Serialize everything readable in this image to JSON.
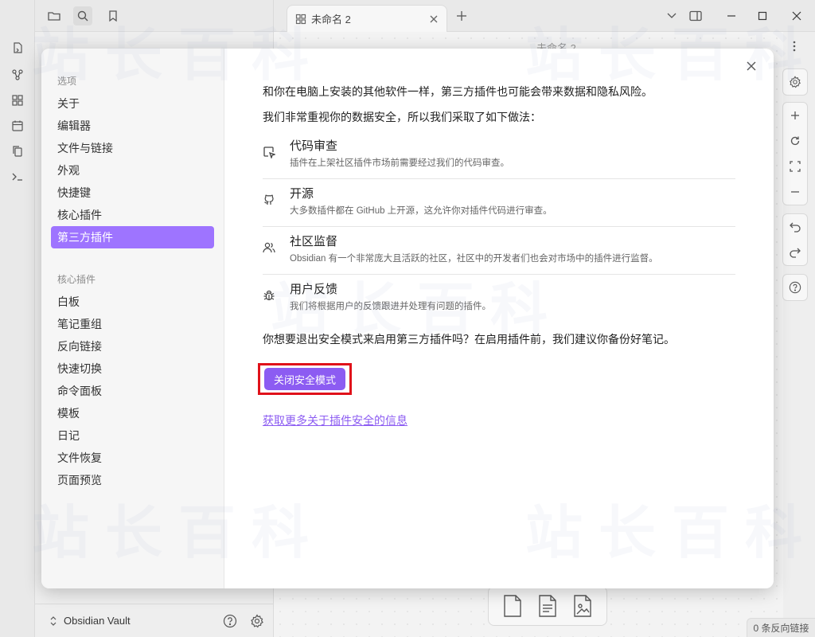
{
  "tab": {
    "title": "未命名 2"
  },
  "editor": {
    "title": "未命名 2"
  },
  "vault": {
    "name": "Obsidian Vault"
  },
  "status": {
    "backlinks": "0 条反向链接"
  },
  "settings": {
    "options_heading": "选项",
    "options": [
      "关于",
      "编辑器",
      "文件与链接",
      "外观",
      "快捷键",
      "核心插件",
      "第三方插件"
    ],
    "active_option": "第三方插件",
    "core_heading": "核心插件",
    "core_plugins": [
      "白板",
      "笔记重组",
      "反向链接",
      "快速切换",
      "命令面板",
      "模板",
      "日记",
      "文件恢复",
      "页面预览"
    ]
  },
  "content": {
    "intro": "和你在电脑上安装的其他软件一样，第三方插件也可能会带来数据和隐私风险。",
    "measures": "我们非常重视你的数据安全，所以我们采取了如下做法：",
    "features": [
      {
        "icon": "code-review-icon",
        "title": "代码审查",
        "desc": "插件在上架社区插件市场前需要经过我们的代码审查。"
      },
      {
        "icon": "github-icon",
        "title": "开源",
        "desc": "大多数插件都在 GitHub 上开源，这允许你对插件代码进行审查。"
      },
      {
        "icon": "community-icon",
        "title": "社区监督",
        "desc": "Obsidian 有一个非常庞大且活跃的社区，社区中的开发者们也会对市场中的插件进行监督。"
      },
      {
        "icon": "bug-icon",
        "title": "用户反馈",
        "desc": "我们将根据用户的反馈跟进并处理有问题的插件。"
      }
    ],
    "question": "你想要退出安全模式来启用第三方插件吗？在启用插件前，我们建议你备份好笔记。",
    "button_label": "关闭安全模式",
    "link": "获取更多关于插件安全的信息"
  },
  "watermark": "站长百科",
  "colors": {
    "accent": "#8c5cf2",
    "active_item": "#9e74ff",
    "highlight": "#e0121a"
  }
}
